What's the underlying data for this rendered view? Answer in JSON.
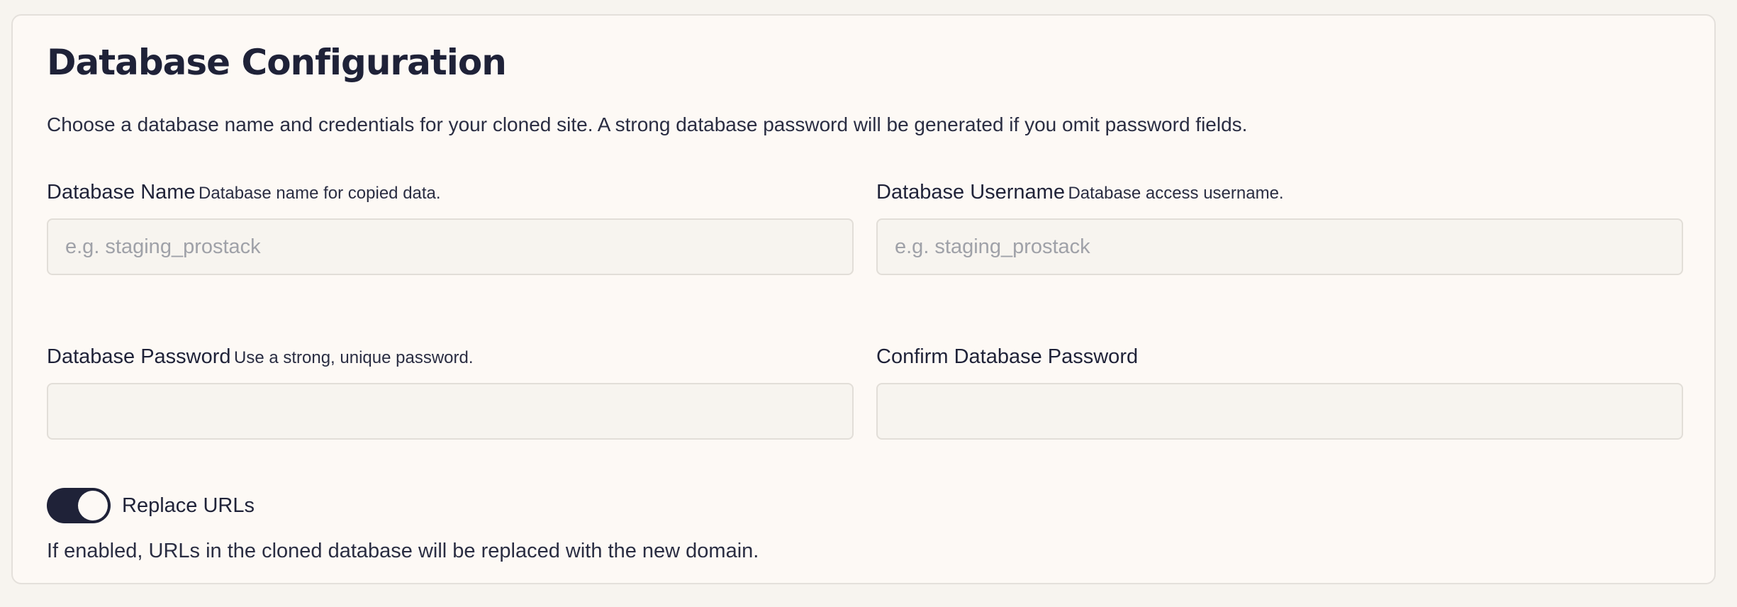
{
  "section": {
    "title": "Database Configuration",
    "description": "Choose a database name and credentials for your cloned site. A strong database password will be generated if you omit password fields."
  },
  "fields": [
    {
      "label": "Database Name",
      "help": "Database name for copied data.",
      "placeholder": "e.g. staging_prostack",
      "value": ""
    },
    {
      "label": "Database Username",
      "help": "Database access username.",
      "placeholder": "e.g. staging_prostack",
      "value": ""
    },
    {
      "label": "Database Password",
      "help": "Use a strong, unique password.",
      "placeholder": "",
      "value": ""
    },
    {
      "label": "Confirm Database Password",
      "help": "",
      "placeholder": "",
      "value": ""
    }
  ],
  "replace_urls": {
    "label": "Replace URLs",
    "enabled": true,
    "help": "If enabled, URLs in the cloned database will be replaced with the new domain."
  },
  "colors": {
    "page_background": "#f7f4ef",
    "card_background": "#fdf9f5",
    "text": "#1f2238",
    "toggle_on": "#1f2238",
    "input_background": "#f7f4ef",
    "input_border": "#e2ded8",
    "placeholder": "#9fa1a8"
  }
}
